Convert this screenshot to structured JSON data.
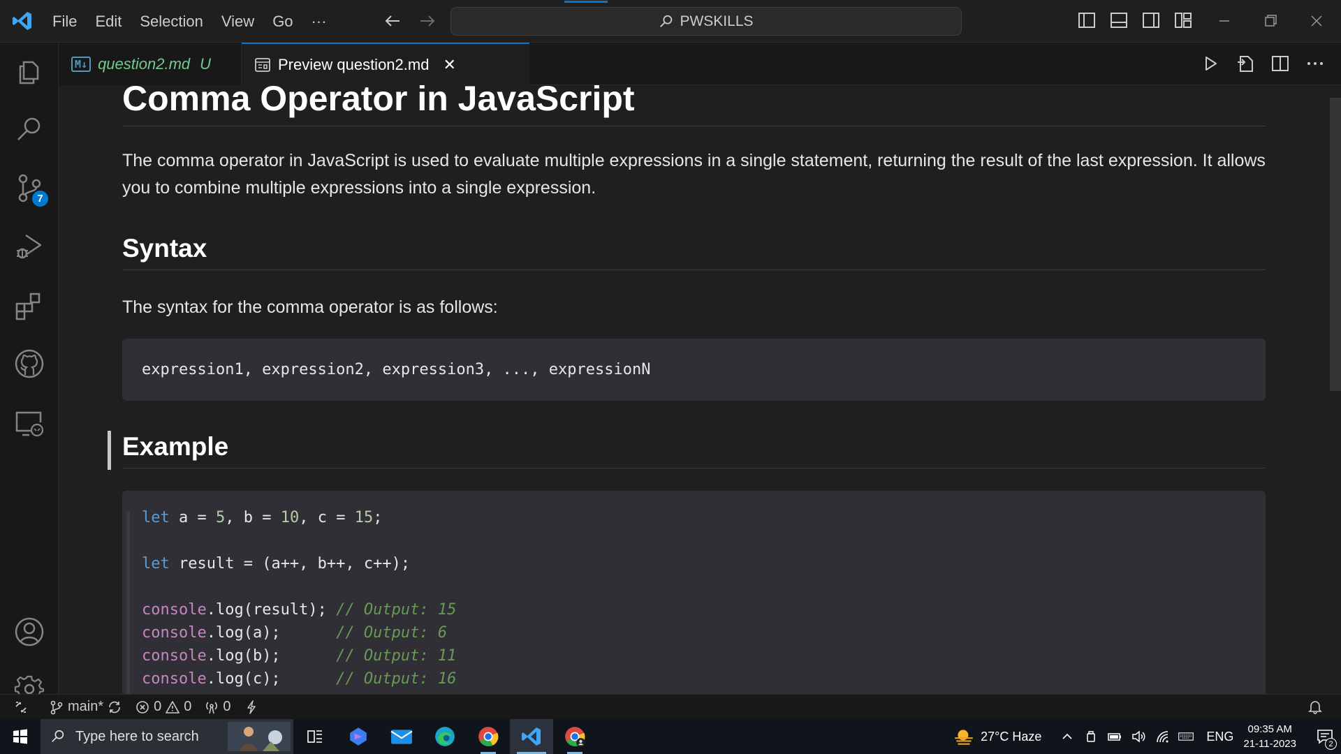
{
  "window": {
    "menu": [
      "File",
      "Edit",
      "Selection",
      "View",
      "Go"
    ],
    "more": "···",
    "search": "PWSKILLS"
  },
  "activitybar": {
    "source_control_badge": "7"
  },
  "tabs": [
    {
      "label": "question2.md",
      "status": "U",
      "icon": "markdown-icon"
    },
    {
      "label": "Preview question2.md",
      "icon": "preview-icon",
      "close": "✕"
    }
  ],
  "doc": {
    "title": "Comma Operator in JavaScript",
    "intro": "The comma operator in JavaScript is used to evaluate multiple expressions in a single statement, returning the result of the last expression. It allows you to combine multiple expressions into a single expression.",
    "syntax_heading": "Syntax",
    "syntax_text": "The syntax for the comma operator is as follows:",
    "syntax_code": "expression1, expression2, expression3, ..., expressionN",
    "example_heading": "Example",
    "example_code": {
      "line1": {
        "kw": "let",
        "a": " a = ",
        "n1": "5",
        "b": ", b = ",
        "n2": "10",
        "c": ", c = ",
        "n3": "15",
        "end": ";"
      },
      "line2": {
        "kw": "let",
        "rest": " result = (a++, b++, c++);"
      },
      "logs": [
        {
          "obj": "console",
          "call": ".log(result); ",
          "comment": "// Output: 15"
        },
        {
          "obj": "console",
          "call": ".log(a);      ",
          "comment": "// Output: 6"
        },
        {
          "obj": "console",
          "call": ".log(b);      ",
          "comment": "// Output: 11"
        },
        {
          "obj": "console",
          "call": ".log(c);      ",
          "comment": "// Output: 16"
        }
      ]
    }
  },
  "statusbar": {
    "branch": "main*",
    "errors": "0",
    "warnings": "0",
    "ports": "0"
  },
  "taskbar": {
    "search_placeholder": "Type here to search",
    "weather": "27°C  Haze",
    "lang": "ENG",
    "time": "09:35 AM",
    "date": "21-11-2023",
    "notifications": "2"
  },
  "colors": {
    "accent": "#0078d4",
    "keyword": "#569cd6",
    "number": "#b5cea8",
    "console": "#c586c0",
    "comment": "#6a9955",
    "untracked": "#73c991"
  }
}
